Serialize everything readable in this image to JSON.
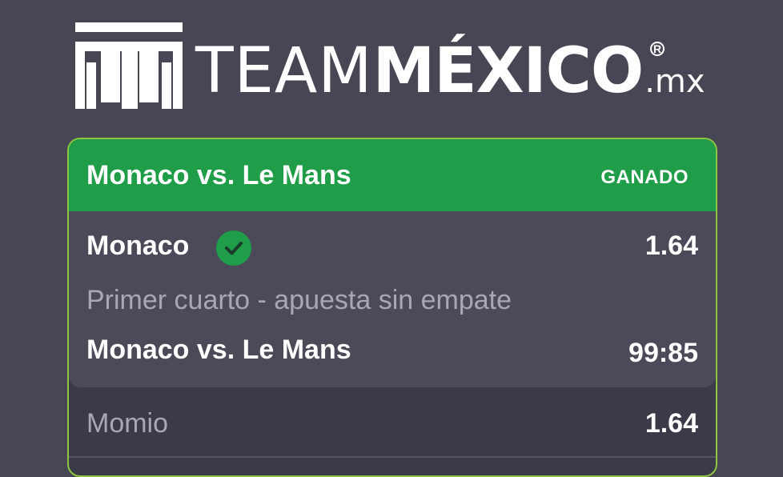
{
  "brand": {
    "name_light": "TEAM",
    "name_bold": "MÉXICO",
    "tld": ".mx",
    "registered": "R",
    "logo_icon": "aztec-fret-icon"
  },
  "bet": {
    "title": "Monaco vs. Le Mans",
    "status": "GANADO",
    "status_color": "#1f9d48",
    "border_color": "#8dc63f",
    "selection": {
      "name": "Monaco",
      "odds": "1.64",
      "won_icon": "check-circle-icon",
      "market": "Primer cuarto - apuesta sin empate",
      "event": "Monaco vs. Le Mans",
      "score": "99:85"
    },
    "momio_label": "Momio",
    "momio_value": "1.64"
  }
}
